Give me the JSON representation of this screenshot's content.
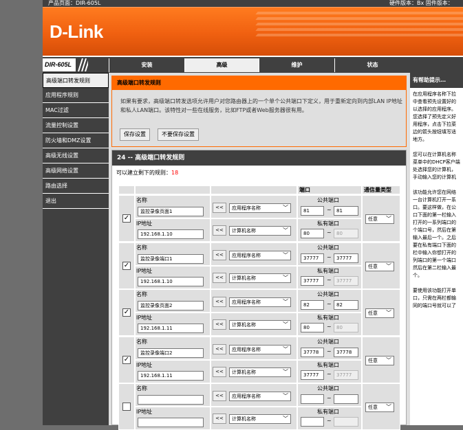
{
  "topbar": {
    "product": "产品页面：DIR-605L",
    "hw": "硬件版本：Bx  固件版本："
  },
  "logo": "D-Link",
  "model": "DIR-605L",
  "tabs": [
    "安装",
    "高级",
    "维护",
    "状态"
  ],
  "active_tab": 1,
  "sidebar": [
    "高级端口转发规则",
    "应用程序规则",
    "MAC过滤",
    "流量控制设置",
    "防火墙和DMZ设置",
    "高级无线设置",
    "高级网络设置",
    "路由选择",
    "退出"
  ],
  "intro": {
    "title": "高级端口转发规则",
    "desc": "如果有要求，高级端口转发选项允许用户对您路由器上的一个单个公共端口下定义，用于重新定向到内部LAN IP地址和私人LAN端口。该特性对一些在线服务，比如FTP或者Web服务器很有用。",
    "save_label": "保存设置",
    "nosave_label": "不要保存设置"
  },
  "rules": {
    "title": "24 -- 高级端口转发规则",
    "remain_label": "可以建立剩下的规则：",
    "remain_count": "18",
    "col_port": "端口",
    "col_traffic": "通信量类型",
    "name_label": "名称",
    "ip_label": "IP地址",
    "public_label": "公共端口",
    "private_label": "私有端口",
    "arrow_label": "<<",
    "app_select": "应用程序名称",
    "pc_select": "计算机名称",
    "tilde": "~",
    "items": [
      {
        "checked": "✓",
        "name": "监控录像页面1",
        "ip": "192.168.1.10",
        "pub_start": "81",
        "pub_end": "81",
        "priv_start": "80",
        "priv_end": "80",
        "traffic": "任意"
      },
      {
        "checked": "✓",
        "name": "监控录像端口1",
        "ip": "192.168.1.10",
        "pub_start": "37777",
        "pub_end": "37777",
        "priv_start": "37777",
        "priv_end": "37777",
        "traffic": "任意"
      },
      {
        "checked": "✓",
        "name": "监控录像页面2",
        "ip": "192.168.1.11",
        "pub_start": "82",
        "pub_end": "82",
        "priv_start": "80",
        "priv_end": "80",
        "traffic": "任意"
      },
      {
        "checked": "✓",
        "name": "监控录像端口2",
        "ip": "192.168.1.11",
        "pub_start": "37778",
        "pub_end": "37778",
        "priv_start": "37777",
        "priv_end": "37777",
        "traffic": "任意"
      },
      {
        "checked": "",
        "name": "",
        "ip": "",
        "pub_start": "",
        "pub_end": "",
        "priv_start": "",
        "priv_end": "",
        "traffic": "任意"
      }
    ]
  },
  "help": {
    "title": "有帮助提示…",
    "text": "在应用程序名称下拉\n中查看预先设置好的\n以选择的应用程序。\n您选择了预先定义好\n用程序，点击下拉菜\n边的箭头按钮填写适\n地方。\n\n您可以在计算机名称\n菜单中的DHCP客户端\n处选择您的计算机，\n手动输入您的计算机\n\n该功能允许您在网络\n一台计算机打开一系\n口。要这样做，在公\n口下面的第一栏输入\n打开的一系列端口的\n个端口号，然后在第\n输入最后一个。之后\n要在私有端口下面的\n栏中输入你想打开的\n列端口的第一个端口\n然后在第二栏输入最\n个。\n\n要使用该功能打开单\n口，只需在两栏都输\n同的端口号就可以了"
  }
}
